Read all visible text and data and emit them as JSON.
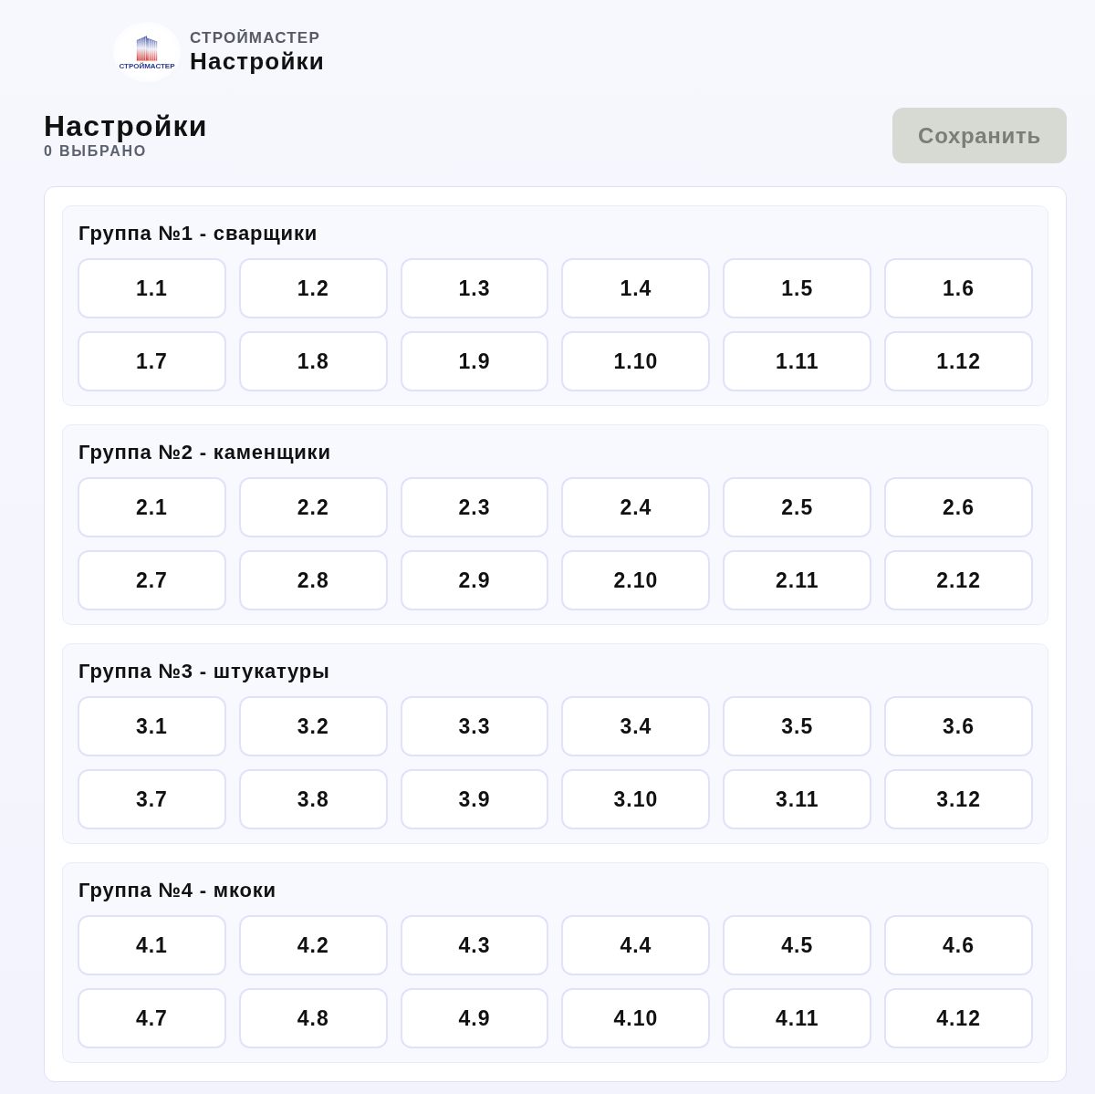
{
  "header": {
    "logo": {
      "text": "СТРОЙМАСТЕР"
    },
    "brand": "СТРОЙМАСТЕР",
    "title": "Настройки"
  },
  "page": {
    "title": "Настройки",
    "selected_count": "0 ВЫБРАНО",
    "save_button": {
      "label": "Сохранить",
      "disabled": true
    }
  },
  "groups": [
    {
      "title": "Группа №1 - сварщики",
      "options": [
        {
          "label": "1.1",
          "selected": false
        },
        {
          "label": "1.2",
          "selected": false
        },
        {
          "label": "1.3",
          "selected": false
        },
        {
          "label": "1.4",
          "selected": false
        },
        {
          "label": "1.5",
          "selected": false
        },
        {
          "label": "1.6",
          "selected": false
        },
        {
          "label": "1.7",
          "selected": false
        },
        {
          "label": "1.8",
          "selected": false
        },
        {
          "label": "1.9",
          "selected": false
        },
        {
          "label": "1.10",
          "selected": false
        },
        {
          "label": "1.11",
          "selected": false
        },
        {
          "label": "1.12",
          "selected": false
        }
      ]
    },
    {
      "title": "Группа №2 - каменщики",
      "options": [
        {
          "label": "2.1",
          "selected": false
        },
        {
          "label": "2.2",
          "selected": false
        },
        {
          "label": "2.3",
          "selected": false
        },
        {
          "label": "2.4",
          "selected": false
        },
        {
          "label": "2.5",
          "selected": false
        },
        {
          "label": "2.6",
          "selected": false
        },
        {
          "label": "2.7",
          "selected": false
        },
        {
          "label": "2.8",
          "selected": false
        },
        {
          "label": "2.9",
          "selected": false
        },
        {
          "label": "2.10",
          "selected": false
        },
        {
          "label": "2.11",
          "selected": false
        },
        {
          "label": "2.12",
          "selected": false
        }
      ]
    },
    {
      "title": "Группа №3 - штукатуры",
      "options": [
        {
          "label": "3.1",
          "selected": false
        },
        {
          "label": "3.2",
          "selected": false
        },
        {
          "label": "3.3",
          "selected": false
        },
        {
          "label": "3.4",
          "selected": false
        },
        {
          "label": "3.5",
          "selected": false
        },
        {
          "label": "3.6",
          "selected": false
        },
        {
          "label": "3.7",
          "selected": false
        },
        {
          "label": "3.8",
          "selected": false
        },
        {
          "label": "3.9",
          "selected": false
        },
        {
          "label": "3.10",
          "selected": false
        },
        {
          "label": "3.11",
          "selected": false
        },
        {
          "label": "3.12",
          "selected": false
        }
      ]
    },
    {
      "title": "Группа №4 - мкоки",
      "options": [
        {
          "label": "4.1",
          "selected": false
        },
        {
          "label": "4.2",
          "selected": false
        },
        {
          "label": "4.3",
          "selected": false
        },
        {
          "label": "4.4",
          "selected": false
        },
        {
          "label": "4.5",
          "selected": false
        },
        {
          "label": "4.6",
          "selected": false
        },
        {
          "label": "4.7",
          "selected": false
        },
        {
          "label": "4.8",
          "selected": false
        },
        {
          "label": "4.9",
          "selected": false
        },
        {
          "label": "4.10",
          "selected": false
        },
        {
          "label": "4.11",
          "selected": false
        },
        {
          "label": "4.12",
          "selected": false
        }
      ]
    }
  ]
}
